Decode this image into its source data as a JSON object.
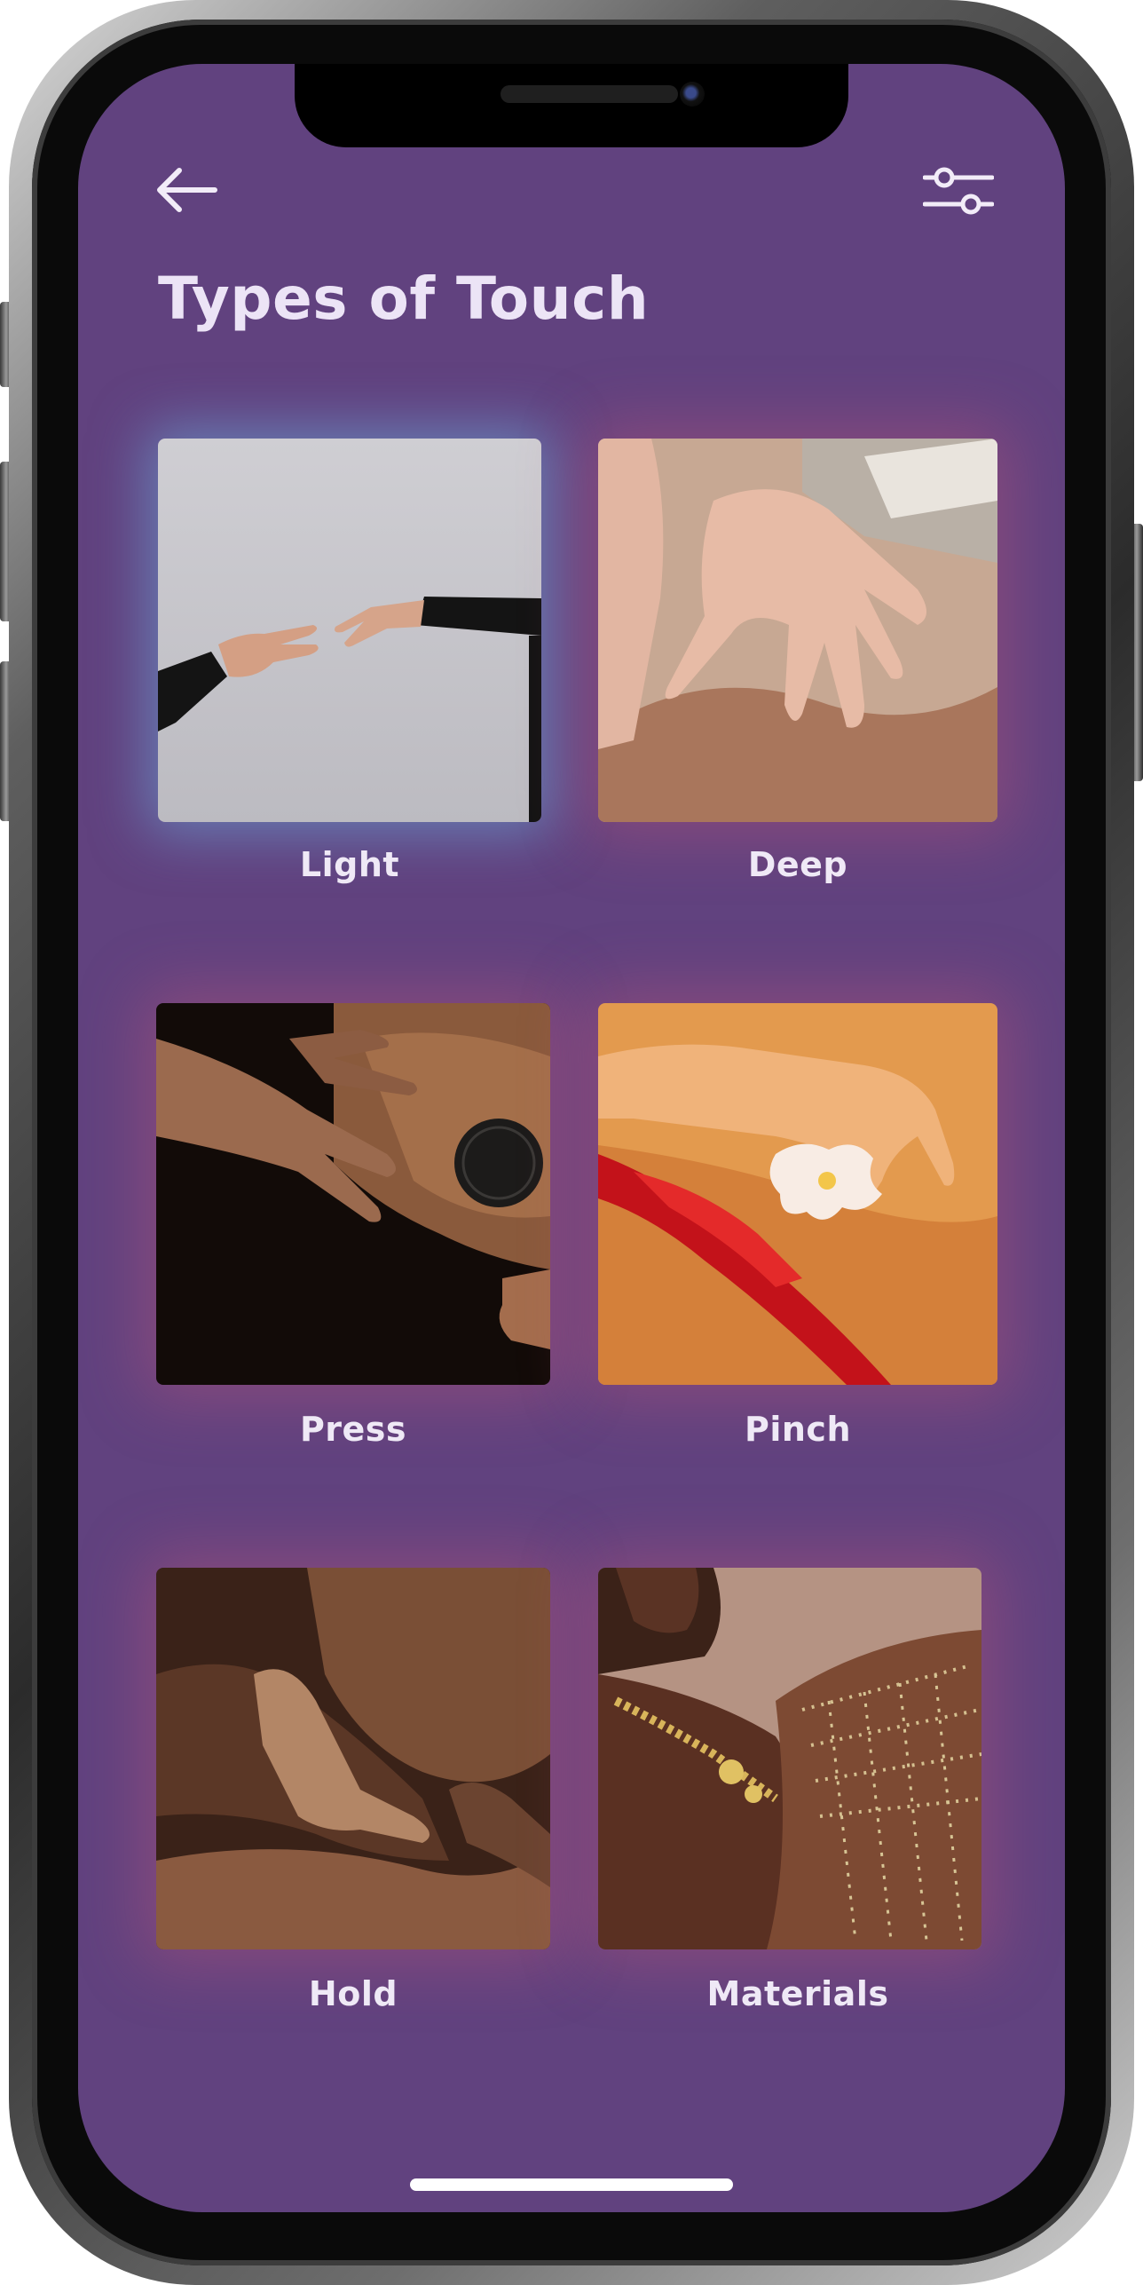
{
  "header": {
    "back_icon": "arrow-left-icon",
    "filter_icon": "sliders-icon",
    "title": "Types of Touch"
  },
  "colors": {
    "screen_background": "#61427f",
    "text": "#ece4f6"
  },
  "touch_types": [
    {
      "label": "Light",
      "image": "two-hands-reaching-photo"
    },
    {
      "label": "Deep",
      "image": "massage-hands-photo"
    },
    {
      "label": "Press",
      "image": "hands-on-back-tattoo-photo"
    },
    {
      "label": "Pinch",
      "image": "hand-with-flowers-red-rope-photo"
    },
    {
      "label": "Hold",
      "image": "embracing-hand-photo"
    },
    {
      "label": "Materials",
      "image": "gold-jewelry-photo"
    }
  ]
}
